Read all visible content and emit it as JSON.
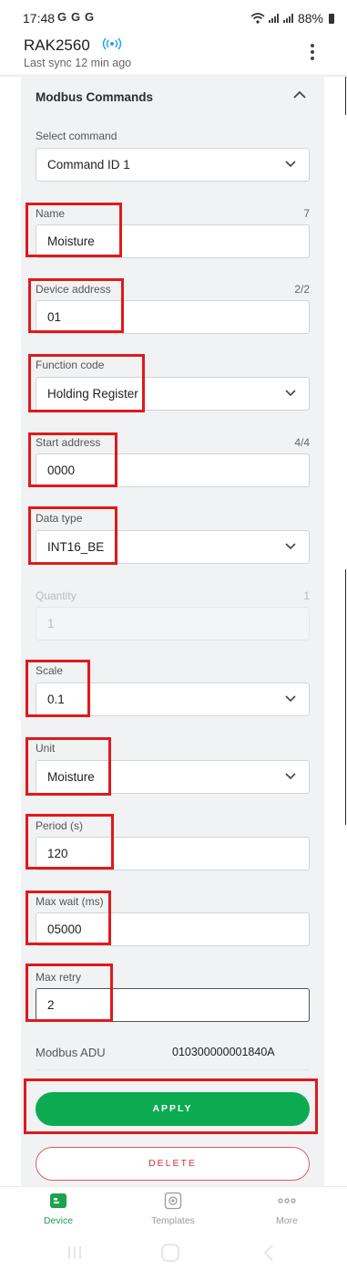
{
  "status_bar": {
    "time": "17:48",
    "battery": "88%",
    "g_icons": [
      "G",
      "G",
      "G"
    ]
  },
  "header": {
    "device_name": "RAK2560",
    "last_sync": "Last sync 12 min ago"
  },
  "section": {
    "title": "Modbus Commands"
  },
  "form": {
    "select_command": {
      "label": "Select command",
      "value": "Command ID 1"
    },
    "name": {
      "label": "Name",
      "value": "Moisture",
      "counter": "7"
    },
    "device_address": {
      "label": "Device address",
      "value": "01",
      "counter": "2/2"
    },
    "function_code": {
      "label": "Function code",
      "value": "Holding Register"
    },
    "start_address": {
      "label": "Start address",
      "value": "0000",
      "counter": "4/4"
    },
    "data_type": {
      "label": "Data type",
      "value": "INT16_BE"
    },
    "quantity": {
      "label": "Quantity",
      "value": "1",
      "counter": "1"
    },
    "scale": {
      "label": "Scale",
      "value": "0.1"
    },
    "unit": {
      "label": "Unit",
      "value": "Moisture"
    },
    "period": {
      "label": "Period (s)",
      "value": "120"
    },
    "max_wait": {
      "label": "Max wait (ms)",
      "value": "05000"
    },
    "max_retry": {
      "label": "Max retry",
      "value": "2"
    }
  },
  "adu": {
    "label": "Modbus ADU",
    "value": "010300000001840A"
  },
  "buttons": {
    "apply": "APPLY",
    "delete": "DELETE"
  },
  "bottom_nav": {
    "device": "Device",
    "templates": "Templates",
    "more": "More"
  },
  "colors": {
    "accent_green": "#0cab52",
    "highlight_red": "#e0191c",
    "delete_red": "#d4343b"
  }
}
